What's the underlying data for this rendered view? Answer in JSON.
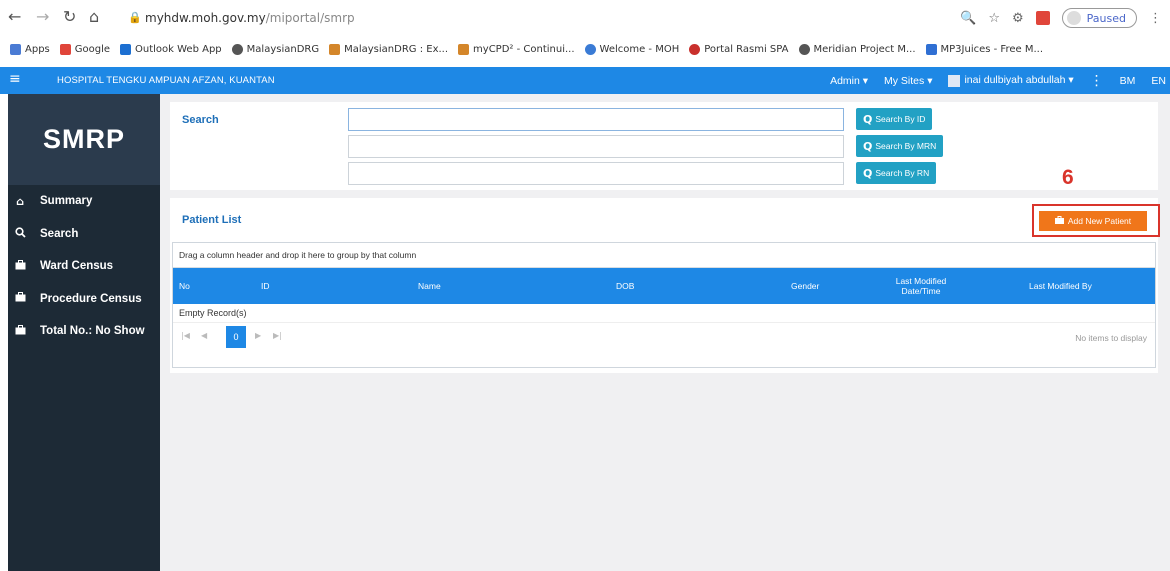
{
  "browser": {
    "url_host": "myhdw.moh.gov.my",
    "url_path": "/miportal/smrp",
    "paused_label": "Paused",
    "bookmarks": [
      {
        "label": "Apps",
        "color": "#4a7bd4"
      },
      {
        "label": "Google",
        "color": "#e0453a"
      },
      {
        "label": "Outlook Web App",
        "color": "#1c6fd1"
      },
      {
        "label": "MalaysianDRG",
        "color": "#555555"
      },
      {
        "label": "MalaysianDRG : Ex...",
        "color": "#d4862a"
      },
      {
        "label": "myCPD² - Continui...",
        "color": "#d4862a"
      },
      {
        "label": "Welcome - MOH",
        "color": "#3a7bd5"
      },
      {
        "label": "Portal Rasmi SPA",
        "color": "#c9302c"
      },
      {
        "label": "Meridian Project M...",
        "color": "#555555"
      },
      {
        "label": "MP3Juices - Free M...",
        "color": "#2f6fd3"
      }
    ]
  },
  "header": {
    "hospital": "HOSPITAL TENGKU AMPUAN AFZAN, KUANTAN",
    "admin": "Admin ▾",
    "my_sites": "My Sites ▾",
    "user": "inai dulbiyah abdullah ▾",
    "lang_bm": "BM",
    "lang_en": "EN"
  },
  "sidebar": {
    "logo": "SMRP",
    "items": [
      {
        "label": "Summary",
        "icon": "home-icon",
        "glyph": "⌂"
      },
      {
        "label": "Search",
        "icon": "search-icon",
        "glyph": "🔍"
      },
      {
        "label": "Ward Census",
        "icon": "briefcase-icon",
        "glyph": "▣"
      },
      {
        "label": "Procedure Census",
        "icon": "briefcase-icon",
        "glyph": "▣"
      },
      {
        "label": "Total No.: No Show",
        "icon": "briefcase-icon",
        "glyph": "▣"
      }
    ]
  },
  "search": {
    "title": "Search",
    "inputs": [
      "",
      "",
      ""
    ],
    "buttons": [
      "Search By ID",
      "Search By MRN",
      "Search By RN"
    ]
  },
  "annotation": "6",
  "patient_list": {
    "title": "Patient List",
    "add_button": "Add New Patient",
    "group_hint": "Drag a column header and drop it here to group by that column",
    "columns": [
      "No",
      "ID",
      "Name",
      "DOB",
      "Gender",
      "Last Modified Date/Time",
      "Last Modified By"
    ],
    "empty_text": "Empty Record(s)",
    "current_page": "0",
    "no_items": "No items to display"
  },
  "colors": {
    "header_blue": "#1e88e5",
    "sidebar_dark": "#1d2a36",
    "search_btn": "#22a1c4",
    "add_btn": "#f0761a",
    "annotation_red": "#d9342b"
  }
}
